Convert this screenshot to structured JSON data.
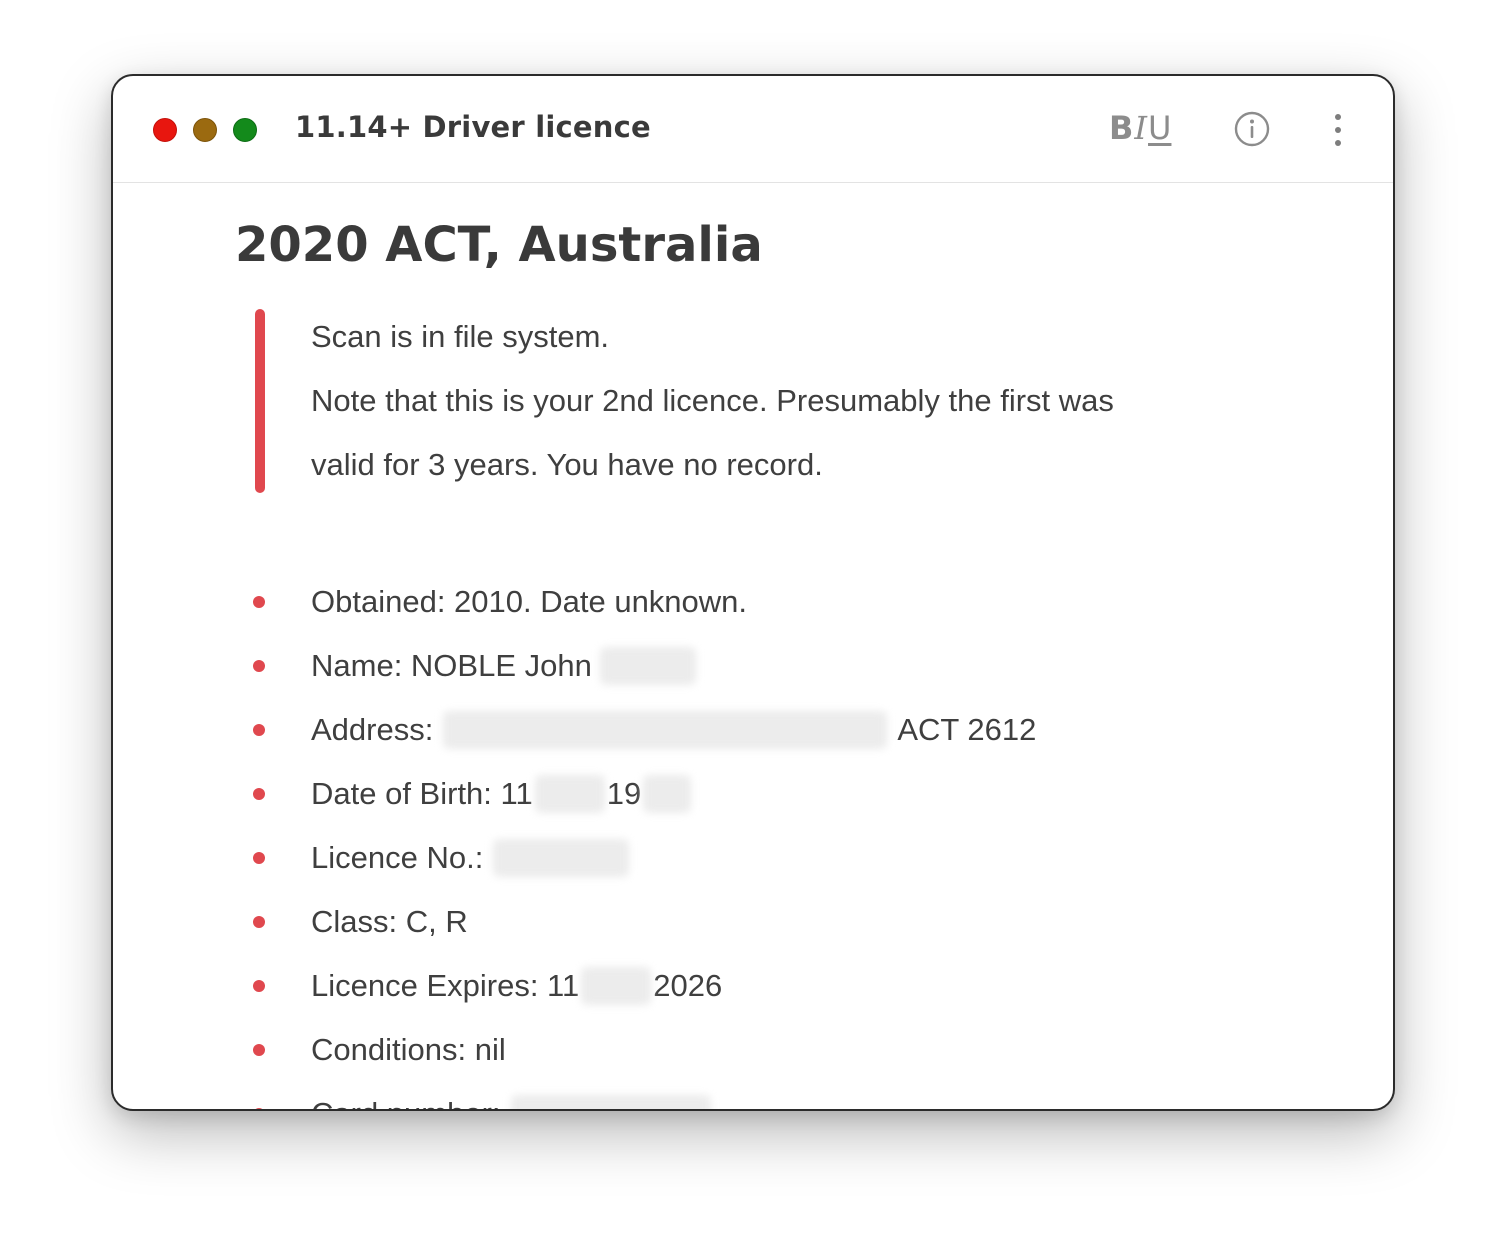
{
  "window": {
    "title": "11.14+ Driver licence"
  },
  "toolbar": {
    "bold_label": "B",
    "italic_label": "I",
    "underline_label": "U"
  },
  "document": {
    "heading": "2020 ACT, Australia",
    "quote": [
      "Scan is in file system.",
      "Note that this is your 2nd licence. Presumably the first was",
      "valid for 3 years. You have no record."
    ],
    "items": {
      "obtained": "Obtained: 2010. Date unknown.",
      "name_prefix": "Name: NOBLE John",
      "address_prefix": "Address:",
      "address_suffix": "ACT 2612",
      "dob_prefix": "Date of Birth: 11",
      "dob_middle": "19",
      "licence_no_prefix": "Licence No.:",
      "class": "Class: C, R",
      "expires_prefix": "Licence Expires: 11",
      "expires_suffix": "2026",
      "conditions": "Conditions: nil",
      "card_number_prefix": "Card number:"
    }
  },
  "colors": {
    "accent": "#e0484e",
    "close": "#e8160f",
    "minimize": "#9b6a10",
    "maximize": "#138a1b"
  },
  "icons": [
    "close-traffic-light",
    "minimize-traffic-light",
    "maximize-traffic-light",
    "info-icon",
    "more-vertical-icon"
  ]
}
